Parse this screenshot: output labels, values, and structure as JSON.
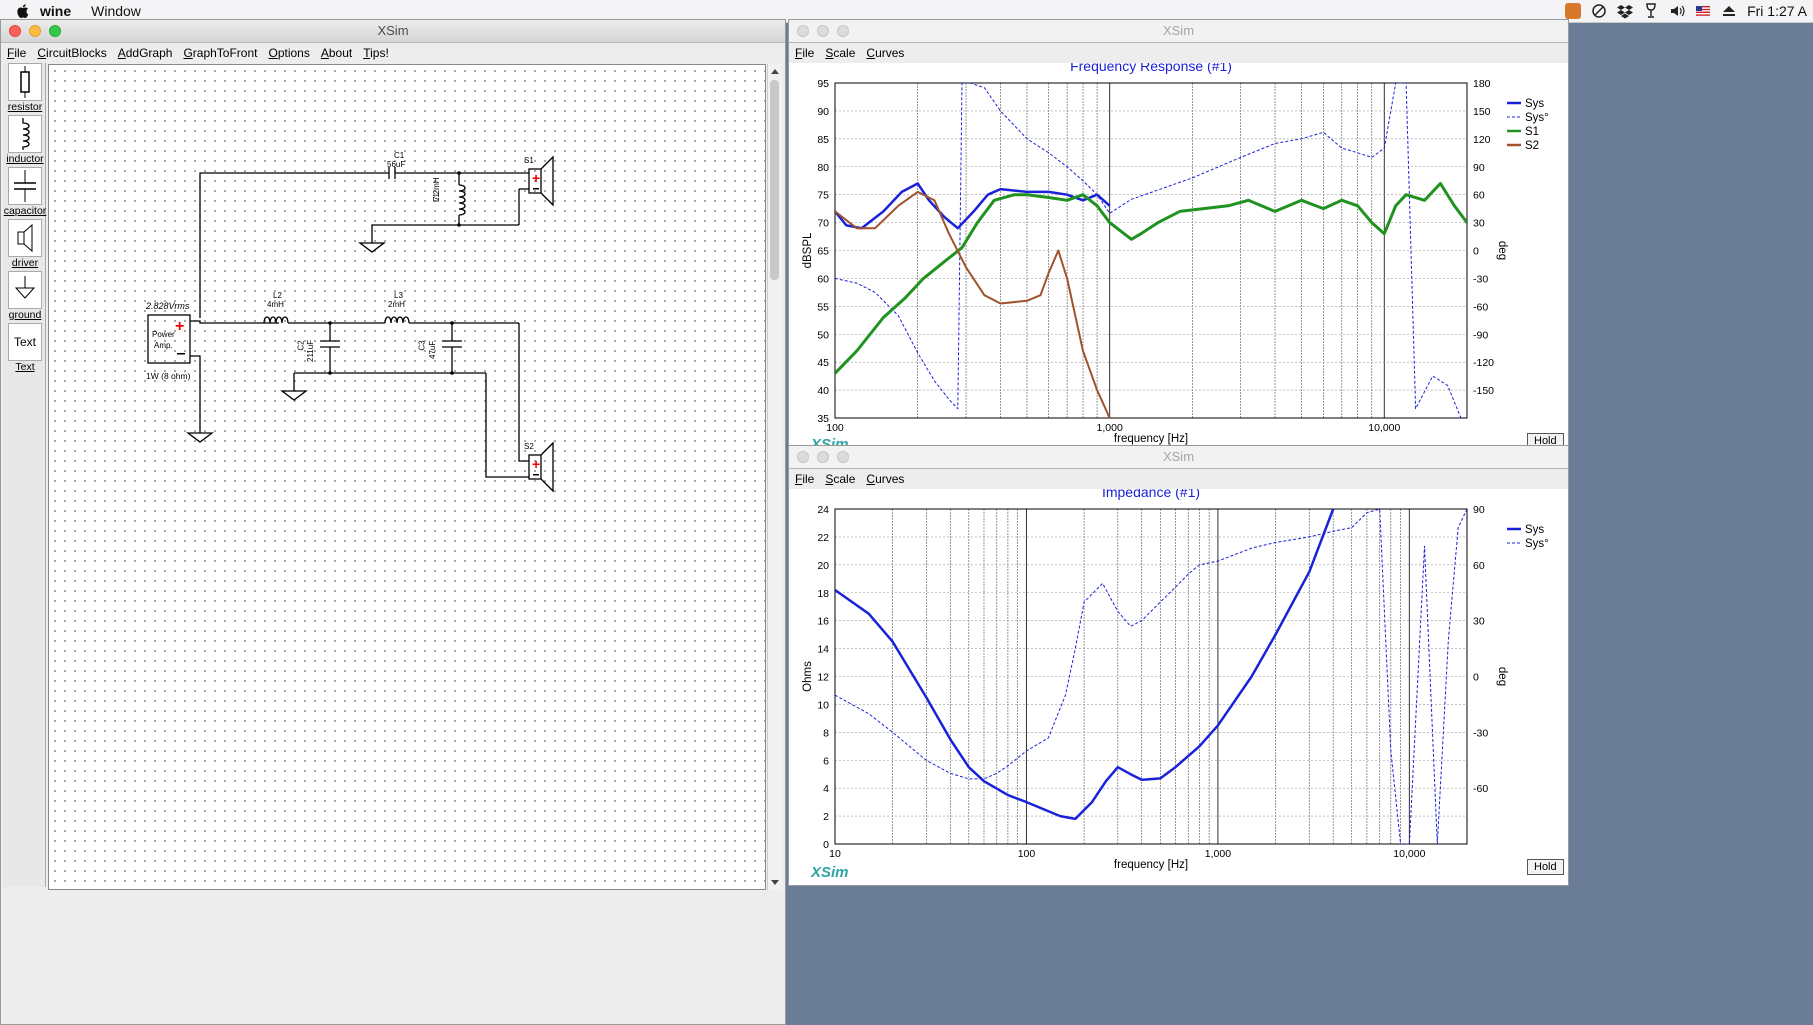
{
  "menubar": {
    "app": "wine",
    "window": "Window",
    "clock": "Fri 1:27 A"
  },
  "circuit_window": {
    "title": "XSim",
    "menu": [
      "File",
      "CircuitBlocks",
      "AddGraph",
      "GraphToFront",
      "Options",
      "About",
      "Tips!"
    ],
    "tools": [
      "resistor",
      "inductor",
      "capacitor",
      "driver",
      "ground",
      "Text"
    ],
    "text_tool_glyph": "Text",
    "source": {
      "voltage": "2.828Vrms",
      "label1": "Power",
      "label2": "Amp.",
      "power": "1W (8 ohm)"
    },
    "components": {
      "C1": {
        "name": "C1",
        "value": "56uF"
      },
      "L1": {
        "name": "L1",
        "value": "7.2mH"
      },
      "L2": {
        "name": "L2",
        "value": "4mH"
      },
      "L3": {
        "name": "L3",
        "value": "2mH"
      },
      "C2": {
        "name": "C2",
        "value": "211uF"
      },
      "C3": {
        "name": "C3",
        "value": "47uF"
      },
      "S1": {
        "name": "S1"
      },
      "S2": {
        "name": "S2"
      }
    }
  },
  "freq_window": {
    "title": "XSim",
    "menu": [
      "File",
      "Scale",
      "Curves"
    ],
    "hold": "Hold",
    "logo": "XSim"
  },
  "imp_window": {
    "title": "XSim",
    "menu": [
      "File",
      "Scale",
      "Curves"
    ],
    "hold": "Hold",
    "logo": "XSim"
  },
  "chart_data": [
    {
      "type": "line",
      "title": "Frequency Response (#1)",
      "xlabel": "frequency [Hz]",
      "ylabel": "dBSPL",
      "y2label": "deg",
      "xscale": "log",
      "xlim": [
        100,
        20000
      ],
      "ylim": [
        35,
        95
      ],
      "y2lim": [
        -180,
        180
      ],
      "x_ticks": [
        "100",
        "1,000",
        "10,000"
      ],
      "y_ticks": [
        "35",
        "40",
        "45",
        "50",
        "55",
        "60",
        "65",
        "70",
        "75",
        "80",
        "85",
        "90",
        "95"
      ],
      "y2_ticks": [
        "-150",
        "-120",
        "-90",
        "-60",
        "-30",
        "0",
        "30",
        "60",
        "90",
        "120",
        "150",
        "180"
      ],
      "legend_position": "right",
      "series": [
        {
          "name": "Sys",
          "color": "#1a22d8",
          "style": "solid",
          "width": 2.5,
          "axis": "left",
          "points": [
            [
              100,
              72
            ],
            [
              110,
              69.5
            ],
            [
              125,
              69
            ],
            [
              150,
              72
            ],
            [
              175,
              75.5
            ],
            [
              200,
              77
            ],
            [
              220,
              74
            ],
            [
              250,
              71
            ],
            [
              280,
              69
            ],
            [
              320,
              72
            ],
            [
              360,
              75
            ],
            [
              400,
              76
            ],
            [
              500,
              75.5
            ],
            [
              600,
              75.5
            ],
            [
              700,
              75
            ],
            [
              800,
              74
            ],
            [
              900,
              75
            ],
            [
              1000,
              73
            ]
          ]
        },
        {
          "name": "Sys°",
          "color": "#1a22d8",
          "style": "dashed",
          "width": 1,
          "axis": "right",
          "points": [
            [
              100,
              -30
            ],
            [
              120,
              -35
            ],
            [
              140,
              -45
            ],
            [
              170,
              -70
            ],
            [
              200,
              -110
            ],
            [
              230,
              -140
            ],
            [
              260,
              -160
            ],
            [
              280,
              -170
            ],
            [
              290,
              180
            ],
            [
              310,
              180
            ],
            [
              350,
              175
            ],
            [
              400,
              150
            ],
            [
              500,
              120
            ],
            [
              600,
              105
            ],
            [
              700,
              90
            ],
            [
              800,
              75
            ],
            [
              900,
              60
            ],
            [
              1000,
              40
            ],
            [
              1200,
              55
            ],
            [
              1500,
              65
            ],
            [
              2000,
              78
            ],
            [
              3000,
              100
            ],
            [
              4000,
              115
            ],
            [
              5000,
              120
            ],
            [
              6000,
              127
            ],
            [
              7000,
              110
            ],
            [
              8000,
              105
            ],
            [
              9000,
              100
            ],
            [
              10000,
              110
            ],
            [
              11000,
              180
            ],
            [
              12000,
              180
            ],
            [
              13000,
              -170
            ],
            [
              15000,
              -135
            ],
            [
              17000,
              -145
            ],
            [
              19000,
              -180
            ]
          ]
        },
        {
          "name": "S1",
          "color": "#20921f",
          "style": "solid",
          "width": 3,
          "axis": "left",
          "points": [
            [
              100,
              43
            ],
            [
              120,
              47
            ],
            [
              150,
              53
            ],
            [
              180,
              56.5
            ],
            [
              210,
              60
            ],
            [
              250,
              63
            ],
            [
              290,
              65.5
            ],
            [
              330,
              70
            ],
            [
              380,
              74
            ],
            [
              450,
              75
            ],
            [
              500,
              75
            ],
            [
              600,
              74.5
            ],
            [
              700,
              74
            ],
            [
              800,
              75
            ],
            [
              900,
              73
            ],
            [
              1000,
              70
            ],
            [
              1200,
              67
            ],
            [
              1300,
              68
            ],
            [
              1500,
              70
            ],
            [
              1800,
              72
            ],
            [
              2200,
              72.5
            ],
            [
              2700,
              73
            ],
            [
              3200,
              74
            ],
            [
              4000,
              72
            ],
            [
              5000,
              74
            ],
            [
              6000,
              72.5
            ],
            [
              7000,
              74
            ],
            [
              8000,
              73
            ],
            [
              9000,
              70
            ],
            [
              10000,
              68
            ],
            [
              11000,
              73
            ],
            [
              12000,
              75
            ],
            [
              14000,
              74
            ],
            [
              16000,
              77
            ],
            [
              18000,
              73
            ],
            [
              20000,
              70
            ]
          ]
        },
        {
          "name": "S2",
          "color": "#a0522d",
          "style": "solid",
          "width": 2,
          "axis": "left",
          "points": [
            [
              100,
              72
            ],
            [
              120,
              69
            ],
            [
              140,
              69
            ],
            [
              170,
              73
            ],
            [
              200,
              75.5
            ],
            [
              230,
              74
            ],
            [
              260,
              68
            ],
            [
              300,
              62
            ],
            [
              350,
              57
            ],
            [
              400,
              55.5
            ],
            [
              500,
              56
            ],
            [
              560,
              57
            ],
            [
              600,
              61
            ],
            [
              650,
              65
            ],
            [
              700,
              60
            ],
            [
              800,
              47
            ],
            [
              900,
              40
            ],
            [
              1000,
              35
            ]
          ]
        }
      ]
    },
    {
      "type": "line",
      "title": "Impedance (#1)",
      "xlabel": "frequency [Hz]",
      "ylabel": "Ohms",
      "y2label": "deg",
      "xscale": "log",
      "xlim": [
        10,
        20000
      ],
      "ylim": [
        0,
        24
      ],
      "y2lim": [
        -90,
        90
      ],
      "x_ticks": [
        "10",
        "100",
        "1,000",
        "10,000"
      ],
      "y_ticks": [
        "0",
        "2",
        "4",
        "6",
        "8",
        "10",
        "12",
        "14",
        "16",
        "18",
        "20",
        "22",
        "24"
      ],
      "y2_ticks": [
        "-60",
        "-30",
        "0",
        "30",
        "60",
        "90"
      ],
      "legend_position": "right",
      "series": [
        {
          "name": "Sys",
          "color": "#1a22d8",
          "style": "solid",
          "width": 2.5,
          "axis": "left",
          "points": [
            [
              10,
              18.2
            ],
            [
              15,
              16.5
            ],
            [
              20,
              14.5
            ],
            [
              30,
              10.5
            ],
            [
              40,
              7.5
            ],
            [
              50,
              5.5
            ],
            [
              60,
              4.5
            ],
            [
              80,
              3.5
            ],
            [
              100,
              3
            ],
            [
              150,
              2
            ],
            [
              180,
              1.8
            ],
            [
              220,
              3
            ],
            [
              260,
              4.5
            ],
            [
              300,
              5.5
            ],
            [
              350,
              5
            ],
            [
              400,
              4.6
            ],
            [
              500,
              4.7
            ],
            [
              600,
              5.5
            ],
            [
              800,
              7
            ],
            [
              1000,
              8.5
            ],
            [
              1500,
              12
            ],
            [
              2000,
              15
            ],
            [
              3000,
              19.5
            ],
            [
              4000,
              24
            ]
          ]
        },
        {
          "name": "Sys°",
          "color": "#1a22d8",
          "style": "dashed",
          "width": 1,
          "axis": "right",
          "points": [
            [
              10,
              -10
            ],
            [
              15,
              -20
            ],
            [
              20,
              -30
            ],
            [
              30,
              -45
            ],
            [
              40,
              -52
            ],
            [
              50,
              -55
            ],
            [
              60,
              -55
            ],
            [
              70,
              -52
            ],
            [
              80,
              -48
            ],
            [
              100,
              -40
            ],
            [
              130,
              -33
            ],
            [
              160,
              -10
            ],
            [
              180,
              15
            ],
            [
              200,
              40
            ],
            [
              250,
              50
            ],
            [
              300,
              35
            ],
            [
              350,
              27
            ],
            [
              400,
              30
            ],
            [
              500,
              40
            ],
            [
              600,
              48
            ],
            [
              700,
              55
            ],
            [
              800,
              60
            ],
            [
              1000,
              62
            ],
            [
              1500,
              69
            ],
            [
              2000,
              72
            ],
            [
              3000,
              75
            ],
            [
              4000,
              78
            ],
            [
              5000,
              80
            ],
            [
              6000,
              88
            ],
            [
              7000,
              90
            ],
            [
              8000,
              -40
            ],
            [
              9000,
              -90
            ],
            [
              10000,
              -90
            ],
            [
              12000,
              70
            ],
            [
              14000,
              -90
            ],
            [
              16000,
              20
            ],
            [
              18000,
              80
            ],
            [
              20000,
              90
            ]
          ]
        }
      ]
    }
  ]
}
